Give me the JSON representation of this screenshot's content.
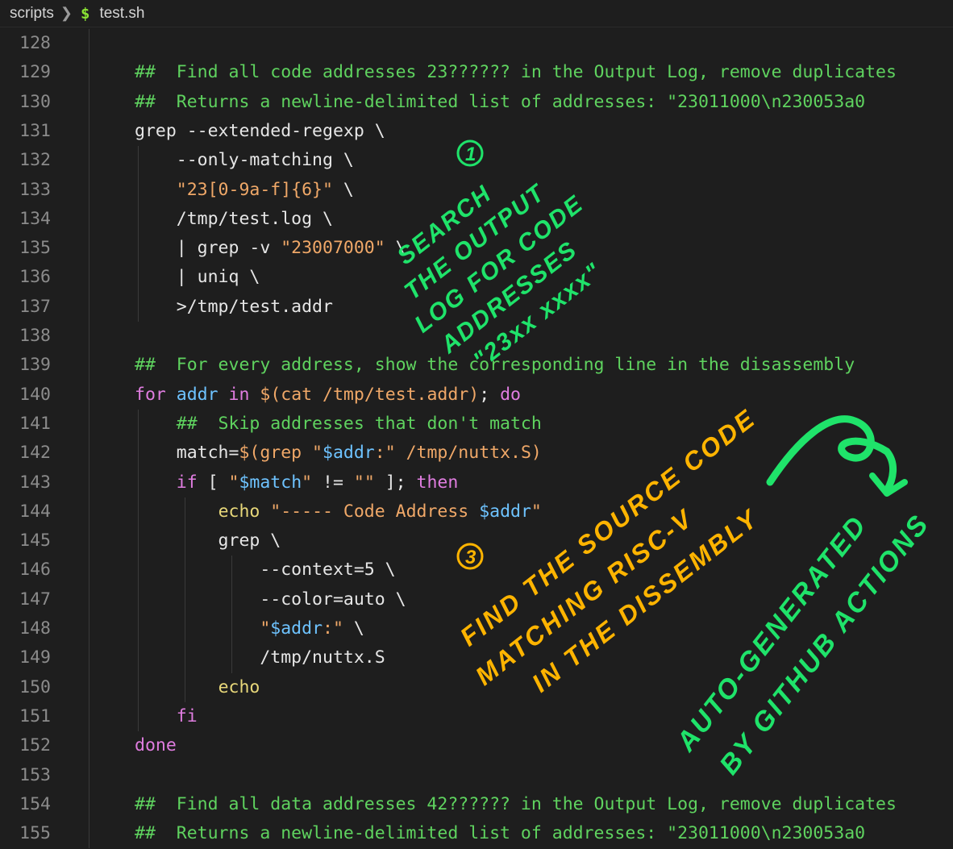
{
  "breadcrumb": {
    "folder": "scripts",
    "file_icon": "$",
    "file": "test.sh"
  },
  "colors": {
    "background": "#1e1e1e",
    "comment": "#5fd35f",
    "string": "#f0a868",
    "keyword": "#e07de0",
    "variable": "#6ec3ff",
    "builtin": "#e8d87a",
    "annotation_green": "#1fe36a",
    "annotation_orange": "#ffb400"
  },
  "lines": [
    {
      "num": "128",
      "parts": []
    },
    {
      "num": "129",
      "parts": [
        {
          "t": "##  Find all code addresses 23?????? in the Output Log, remove duplicates",
          "c": "c"
        }
      ]
    },
    {
      "num": "130",
      "parts": [
        {
          "t": "##  Returns a newline-delimited list of addresses: \"23011000\\n230053a0",
          "c": "c"
        }
      ]
    },
    {
      "num": "131",
      "parts": [
        {
          "t": "grep --extended-regexp \\",
          "c": ""
        }
      ]
    },
    {
      "num": "132",
      "parts": [
        {
          "t": "    --only-matching \\",
          "c": ""
        }
      ]
    },
    {
      "num": "133",
      "parts": [
        {
          "t": "    ",
          "c": ""
        },
        {
          "t": "\"23[0-9a-f]{6}\"",
          "c": "s"
        },
        {
          "t": " \\",
          "c": ""
        }
      ]
    },
    {
      "num": "134",
      "parts": [
        {
          "t": "    /tmp/test.log \\",
          "c": ""
        }
      ]
    },
    {
      "num": "135",
      "parts": [
        {
          "t": "    | grep -v ",
          "c": ""
        },
        {
          "t": "\"23007000\"",
          "c": "s"
        },
        {
          "t": " \\",
          "c": ""
        }
      ]
    },
    {
      "num": "136",
      "parts": [
        {
          "t": "    | uniq \\",
          "c": ""
        }
      ]
    },
    {
      "num": "137",
      "parts": [
        {
          "t": "    >/tmp/test.addr",
          "c": ""
        }
      ]
    },
    {
      "num": "138",
      "parts": []
    },
    {
      "num": "139",
      "parts": [
        {
          "t": "##  For every address, show the corresponding line in the disassembly",
          "c": "c"
        }
      ]
    },
    {
      "num": "140",
      "parts": [
        {
          "t": "for",
          "c": "k"
        },
        {
          "t": " ",
          "c": ""
        },
        {
          "t": "addr",
          "c": "v"
        },
        {
          "t": " ",
          "c": ""
        },
        {
          "t": "in",
          "c": "k"
        },
        {
          "t": " ",
          "c": ""
        },
        {
          "t": "$(cat /tmp/test.addr)",
          "c": "s"
        },
        {
          "t": "; ",
          "c": ""
        },
        {
          "t": "do",
          "c": "k"
        }
      ]
    },
    {
      "num": "141",
      "parts": [
        {
          "t": "    ",
          "c": ""
        },
        {
          "t": "##  Skip addresses that don't match",
          "c": "c"
        }
      ]
    },
    {
      "num": "142",
      "parts": [
        {
          "t": "    match=",
          "c": ""
        },
        {
          "t": "$(grep \"",
          "c": "s"
        },
        {
          "t": "$addr",
          "c": "v"
        },
        {
          "t": ":\" /tmp/nuttx.S)",
          "c": "s"
        }
      ]
    },
    {
      "num": "143",
      "parts": [
        {
          "t": "    ",
          "c": ""
        },
        {
          "t": "if",
          "c": "k"
        },
        {
          "t": " [ ",
          "c": ""
        },
        {
          "t": "\"",
          "c": "s"
        },
        {
          "t": "$match",
          "c": "v"
        },
        {
          "t": "\"",
          "c": "s"
        },
        {
          "t": " != ",
          "c": ""
        },
        {
          "t": "\"\"",
          "c": "s"
        },
        {
          "t": " ]; ",
          "c": ""
        },
        {
          "t": "then",
          "c": "k"
        }
      ]
    },
    {
      "num": "144",
      "parts": [
        {
          "t": "        ",
          "c": ""
        },
        {
          "t": "echo",
          "c": "y"
        },
        {
          "t": " ",
          "c": ""
        },
        {
          "t": "\"----- Code Address ",
          "c": "s"
        },
        {
          "t": "$addr",
          "c": "v"
        },
        {
          "t": "\"",
          "c": "s"
        }
      ]
    },
    {
      "num": "145",
      "parts": [
        {
          "t": "        grep \\",
          "c": ""
        }
      ]
    },
    {
      "num": "146",
      "parts": [
        {
          "t": "            --context=5 \\",
          "c": ""
        }
      ]
    },
    {
      "num": "147",
      "parts": [
        {
          "t": "            --color=auto \\",
          "c": ""
        }
      ]
    },
    {
      "num": "148",
      "parts": [
        {
          "t": "            ",
          "c": ""
        },
        {
          "t": "\"",
          "c": "s"
        },
        {
          "t": "$addr",
          "c": "v"
        },
        {
          "t": ":\"",
          "c": "s"
        },
        {
          "t": " \\",
          "c": ""
        }
      ]
    },
    {
      "num": "149",
      "parts": [
        {
          "t": "            /tmp/nuttx.S",
          "c": ""
        }
      ]
    },
    {
      "num": "150",
      "parts": [
        {
          "t": "        ",
          "c": ""
        },
        {
          "t": "echo",
          "c": "y"
        }
      ]
    },
    {
      "num": "151",
      "parts": [
        {
          "t": "    ",
          "c": ""
        },
        {
          "t": "fi",
          "c": "k"
        }
      ]
    },
    {
      "num": "152",
      "parts": [
        {
          "t": "done",
          "c": "k"
        }
      ]
    },
    {
      "num": "153",
      "parts": []
    },
    {
      "num": "154",
      "parts": [
        {
          "t": "##  Find all data addresses 42?????? in the Output Log, remove duplicates",
          "c": "c"
        }
      ]
    },
    {
      "num": "155",
      "parts": [
        {
          "t": "##  Returns a newline-delimited list of addresses: \"23011000\\n230053a0",
          "c": "c"
        }
      ]
    }
  ],
  "annotations": {
    "note1_number": "1",
    "note1_lines": [
      "SEARCH",
      "THE OUTPUT",
      "LOG FOR CODE",
      "ADDRESSES",
      "\"23xx xxxx\""
    ],
    "note3_number": "3",
    "note3_lines": [
      "FIND THE SOURCE CODE",
      "MATCHING RISC-V",
      "IN THE DISSEMBLY"
    ],
    "note_auto_lines": [
      "AUTO-GENERATED",
      "BY GITHUB ACTIONS"
    ]
  }
}
